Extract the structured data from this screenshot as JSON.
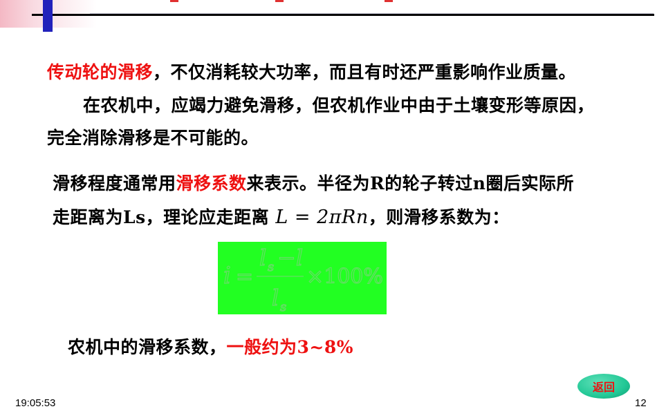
{
  "paragraph1": {
    "highlight": "传动轮的滑移",
    "rest": "，不仅消耗较大功率，而且有时还严重影响作业质量。"
  },
  "paragraph2": {
    "line1": "在农机中，应竭力避免滑移，但农机作业中由于土壤变形等原因，",
    "line2": "完全消除滑移是不可能的。"
  },
  "paragraph3": {
    "line1_pre": "滑移程度通常用",
    "line1_highlight": "滑移系数",
    "line1_post": "来表示。半径为R的轮子转过n圈后实际所",
    "line2_pre": "走距离为Ls，理论应走距离",
    "line2_math": "L = 2πRn",
    "line2_post": "，则滑移系数为："
  },
  "formula": {
    "lhs": "i",
    "eq": "=",
    "numerator": "l",
    "numerator_sub": "s",
    "minus_l": "−l",
    "denominator": "l",
    "denominator_sub": "s",
    "times": "×100%"
  },
  "paragraph4": {
    "pre": "农机中的滑移系数，",
    "highlight": "一般约为3~8%"
  },
  "return_button": "返回",
  "footer": {
    "time": "19:05:53",
    "page": "12"
  },
  "colors": {
    "highlight": "#ee1111",
    "formula_bg": "#22ff22",
    "accent_bar": "#2222bb"
  }
}
